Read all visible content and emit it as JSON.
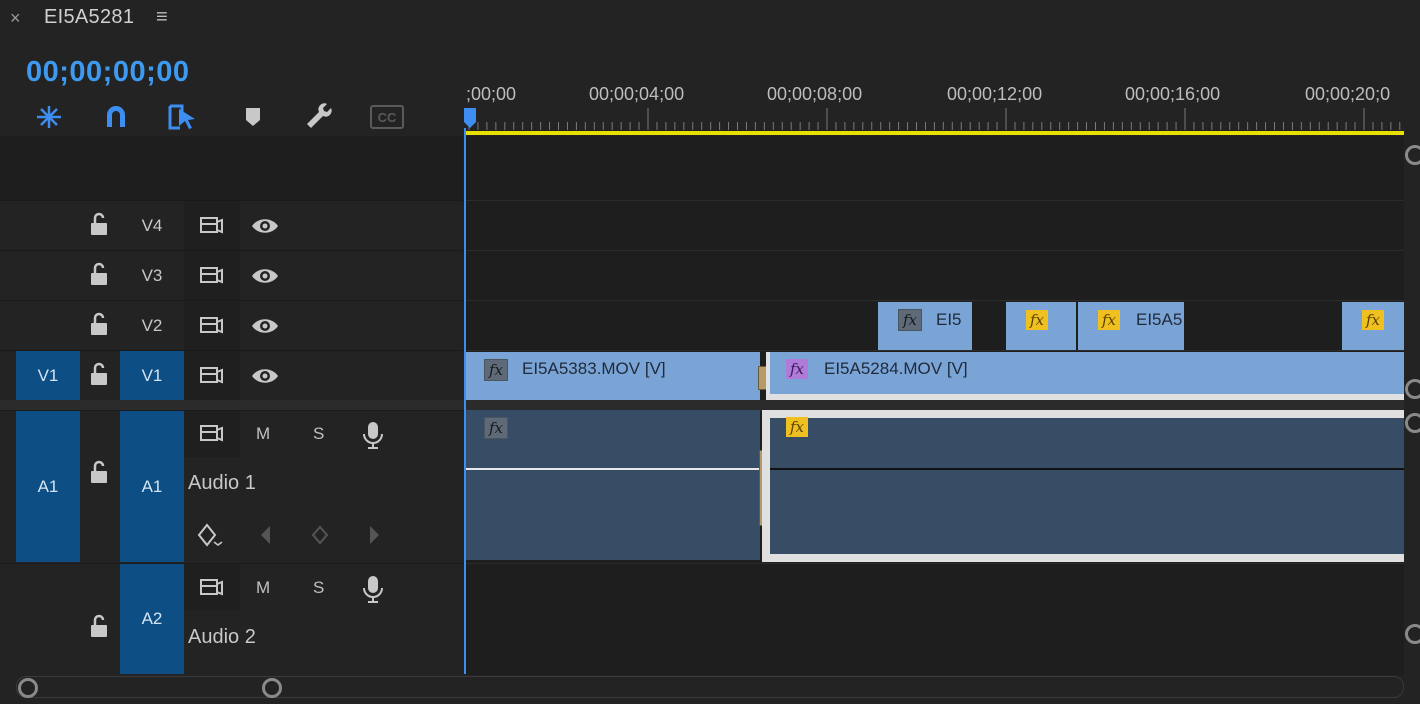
{
  "header": {
    "close_glyph": "×",
    "sequence_name": "EI5A5281",
    "menu_glyph": "≡",
    "timecode": "00;00;00;00"
  },
  "toolbar": {
    "tools": [
      "insert-overwrite-icon",
      "snap-magnet-icon",
      "linked-selection-icon",
      "add-marker-icon",
      "wrench-icon",
      "captions-icon"
    ],
    "captions_label": "CC"
  },
  "ruler": {
    "labels": [
      ";00;00",
      "00;00;04;00",
      "00;00;08;00",
      "00;00;12;00",
      "00;00;16;00",
      "00;00;20;0"
    ]
  },
  "tracks": {
    "v4": {
      "label": "V4"
    },
    "v3": {
      "label": "V3"
    },
    "v2": {
      "label": "V2"
    },
    "v1": {
      "source": "V1",
      "label": "V1"
    },
    "a1": {
      "source": "A1",
      "label": "A1",
      "name": "Audio 1",
      "mute": "M",
      "solo": "S"
    },
    "a2": {
      "label": "A2",
      "name": "Audio 2",
      "mute": "M",
      "solo": "S"
    }
  },
  "clips": {
    "v2_1": "EI5",
    "v2_3": "EI5A5",
    "v1_1": "EI5A5383.MOV [V]",
    "v1_2": "EI5A5284.MOV [V]",
    "fx": "fx"
  },
  "colors": {
    "accent": "#3d9af0",
    "track_target": "#0d4e84",
    "video_clip": "#7ba4d6",
    "audio_clip": "#374d66",
    "fx_yellow": "#f0c020",
    "work_area": "#e8e000"
  }
}
